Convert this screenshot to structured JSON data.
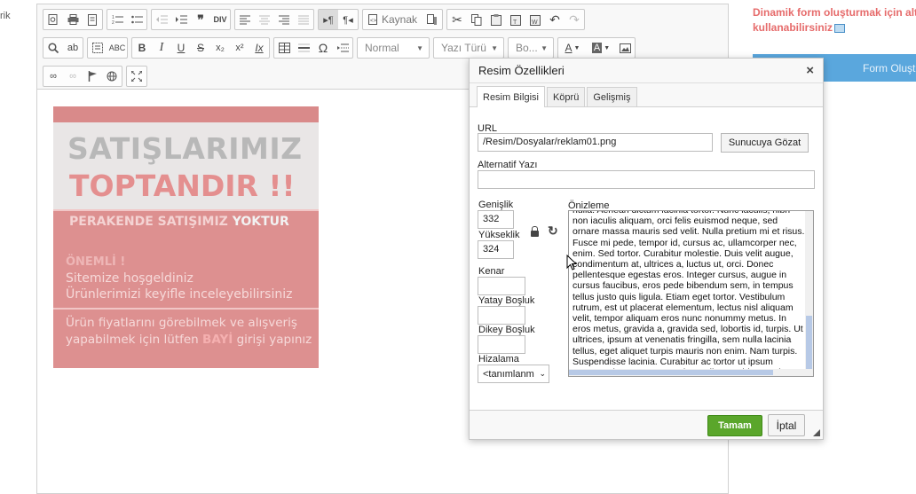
{
  "left_crop_text": "rik",
  "toolbar": {
    "source_label": "Kaynak",
    "format_placeholder": "Normal",
    "font_placeholder": "Yazı Türü",
    "size_placeholder": "Bo..."
  },
  "banner": {
    "line1": "SATIŞLARIMIZ",
    "line2": "TOPTANDIR !!",
    "line3_prefix": "PERAKENDE SATIŞIMIZ ",
    "line3_highlight": "YOKTUR",
    "line4": "ÖNEMLİ !",
    "line5": "Sitemize hoşgeldiniz",
    "line6": "Ürünlerimizi keyifle inceleyebilirsiniz",
    "line7": "Ürün fiyatlarını görebilmek ve alışveriş",
    "line8_prefix": "yapabilmek için lütfen ",
    "line8_highlight": "BAYİ",
    "line8_suffix": " girişi yapınız"
  },
  "right_panel": {
    "note_line1": "Dinamik form oluşturmak için alt t",
    "note_line2": "kullanabilirsiniz",
    "button_label": "Form Oluşt"
  },
  "dialog": {
    "title": "Resim Özellikleri",
    "close_symbol": "×",
    "tabs": [
      "Resim Bilgisi",
      "Köprü",
      "Gelişmiş"
    ],
    "url_label": "URL",
    "url_value": "/Resim/Dosyalar/reklam01.png",
    "browse_label": "Sunucuya Gözat",
    "alt_label": "Alternatif Yazı",
    "alt_value": "",
    "width_label": "Genişlik",
    "width_value": "332",
    "height_label": "Yükseklik",
    "height_value": "324",
    "border_label": "Kenar",
    "border_value": "",
    "hspace_label": "Yatay Boşluk",
    "hspace_value": "",
    "vspace_label": "Dikey Boşluk",
    "vspace_value": "",
    "align_label": "Hizalama",
    "align_value": "<tanımlanm",
    "preview_label": "Önizleme",
    "preview_text": "nulla. Aenean dictum lacinia tortor. Nunc iaculis, nibh non iaculis aliquam, orci felis euismod neque, sed ornare massa mauris sed velit. Nulla pretium mi et risus. Fusce mi pede, tempor id, cursus ac, ullamcorper nec, enim. Sed tortor. Curabitur molestie. Duis velit augue, condimentum at, ultrices a, luctus ut, orci. Donec pellentesque egestas eros. Integer cursus, augue in cursus faucibus, eros pede bibendum sem, in tempus tellus justo quis ligula. Etiam eget tortor. Vestibulum rutrum, est ut placerat elementum, lectus nisl aliquam velit, tempor aliquam eros nunc nonummy metus. In eros metus, gravida a, gravida sed, lobortis id, turpis. Ut ultrices, ipsum at venenatis fringilla, sem nulla lacinia tellus, eget aliquet turpis mauris non enim. Nam turpis. Suspendisse lacinia. Curabitur ac tortor ut ipsum egestas elementum. Nunc imperdiet gravida mauris.",
    "ok_label": "Tamam",
    "cancel_label": "İptal"
  },
  "colors": {
    "accent_red": "#e66b6b",
    "accent_blue": "#5aa7dd",
    "ok_green": "#5aa62b"
  }
}
